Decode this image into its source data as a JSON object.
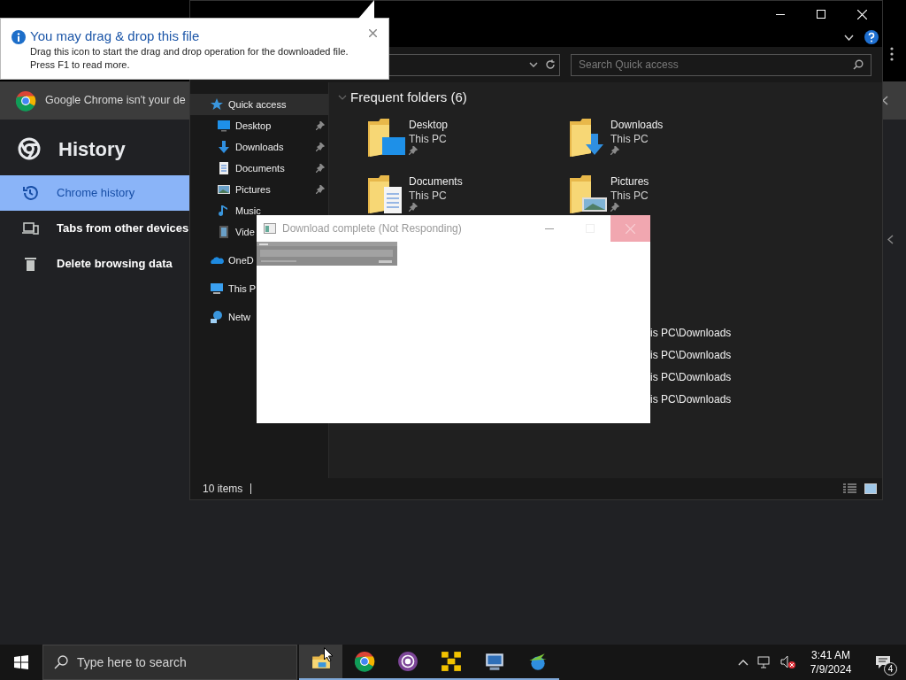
{
  "balloon": {
    "title": "You may drag & drop this file",
    "lines": [
      "Drag this icon to start the drag and drop operation for the downloaded file.",
      "Press F1 to read more."
    ]
  },
  "chrome": {
    "infobar": "Google Chrome isn't your de",
    "title": "History",
    "nav": [
      {
        "label": "Chrome history",
        "selected": true
      },
      {
        "label": "Tabs from other devices",
        "selected": false
      },
      {
        "label": "Delete browsing data",
        "selected": false
      }
    ]
  },
  "explorer": {
    "search_placeholder": "Search Quick access",
    "nav": [
      {
        "label": "Quick access",
        "kind": "root",
        "selected": true
      },
      {
        "label": "Desktop",
        "kind": "child",
        "selected": false,
        "pinned": true
      },
      {
        "label": "Downloads",
        "kind": "child",
        "selected": false,
        "pinned": true
      },
      {
        "label": "Documents",
        "kind": "child",
        "selected": false,
        "pinned": true
      },
      {
        "label": "Pictures",
        "kind": "child",
        "selected": false,
        "pinned": true
      },
      {
        "label": "Music",
        "kind": "child",
        "selected": false,
        "pinned": false
      },
      {
        "label": "Vide",
        "kind": "child",
        "selected": false
      },
      {
        "label": "OneD",
        "kind": "root",
        "selected": false
      },
      {
        "label": "This P",
        "kind": "root",
        "selected": false
      },
      {
        "label": "Netw",
        "kind": "root",
        "selected": false
      }
    ],
    "section": "Frequent folders (6)",
    "folders": [
      {
        "name": "Desktop",
        "location": "This PC",
        "pinned": true
      },
      {
        "name": "Downloads",
        "location": "This PC",
        "pinned": true
      },
      {
        "name": "Documents",
        "location": "This PC",
        "pinned": true
      },
      {
        "name": "Pictures",
        "location": "This PC",
        "pinned": true
      }
    ],
    "recent_rows": [
      "is PC\\Downloads",
      "is PC\\Downloads",
      "is PC\\Downloads",
      "is PC\\Downloads"
    ],
    "status": "10 items"
  },
  "dialog": {
    "title": "Download complete (Not Responding)"
  },
  "taskbar": {
    "search_placeholder": "Type here to search",
    "apps": [
      {
        "active": true
      },
      {
        "active": false
      },
      {
        "active": false
      },
      {
        "active": false
      },
      {
        "active": false
      },
      {
        "active": false
      }
    ],
    "time": "3:41 AM",
    "date": "7/9/2024",
    "notifications": "4"
  }
}
